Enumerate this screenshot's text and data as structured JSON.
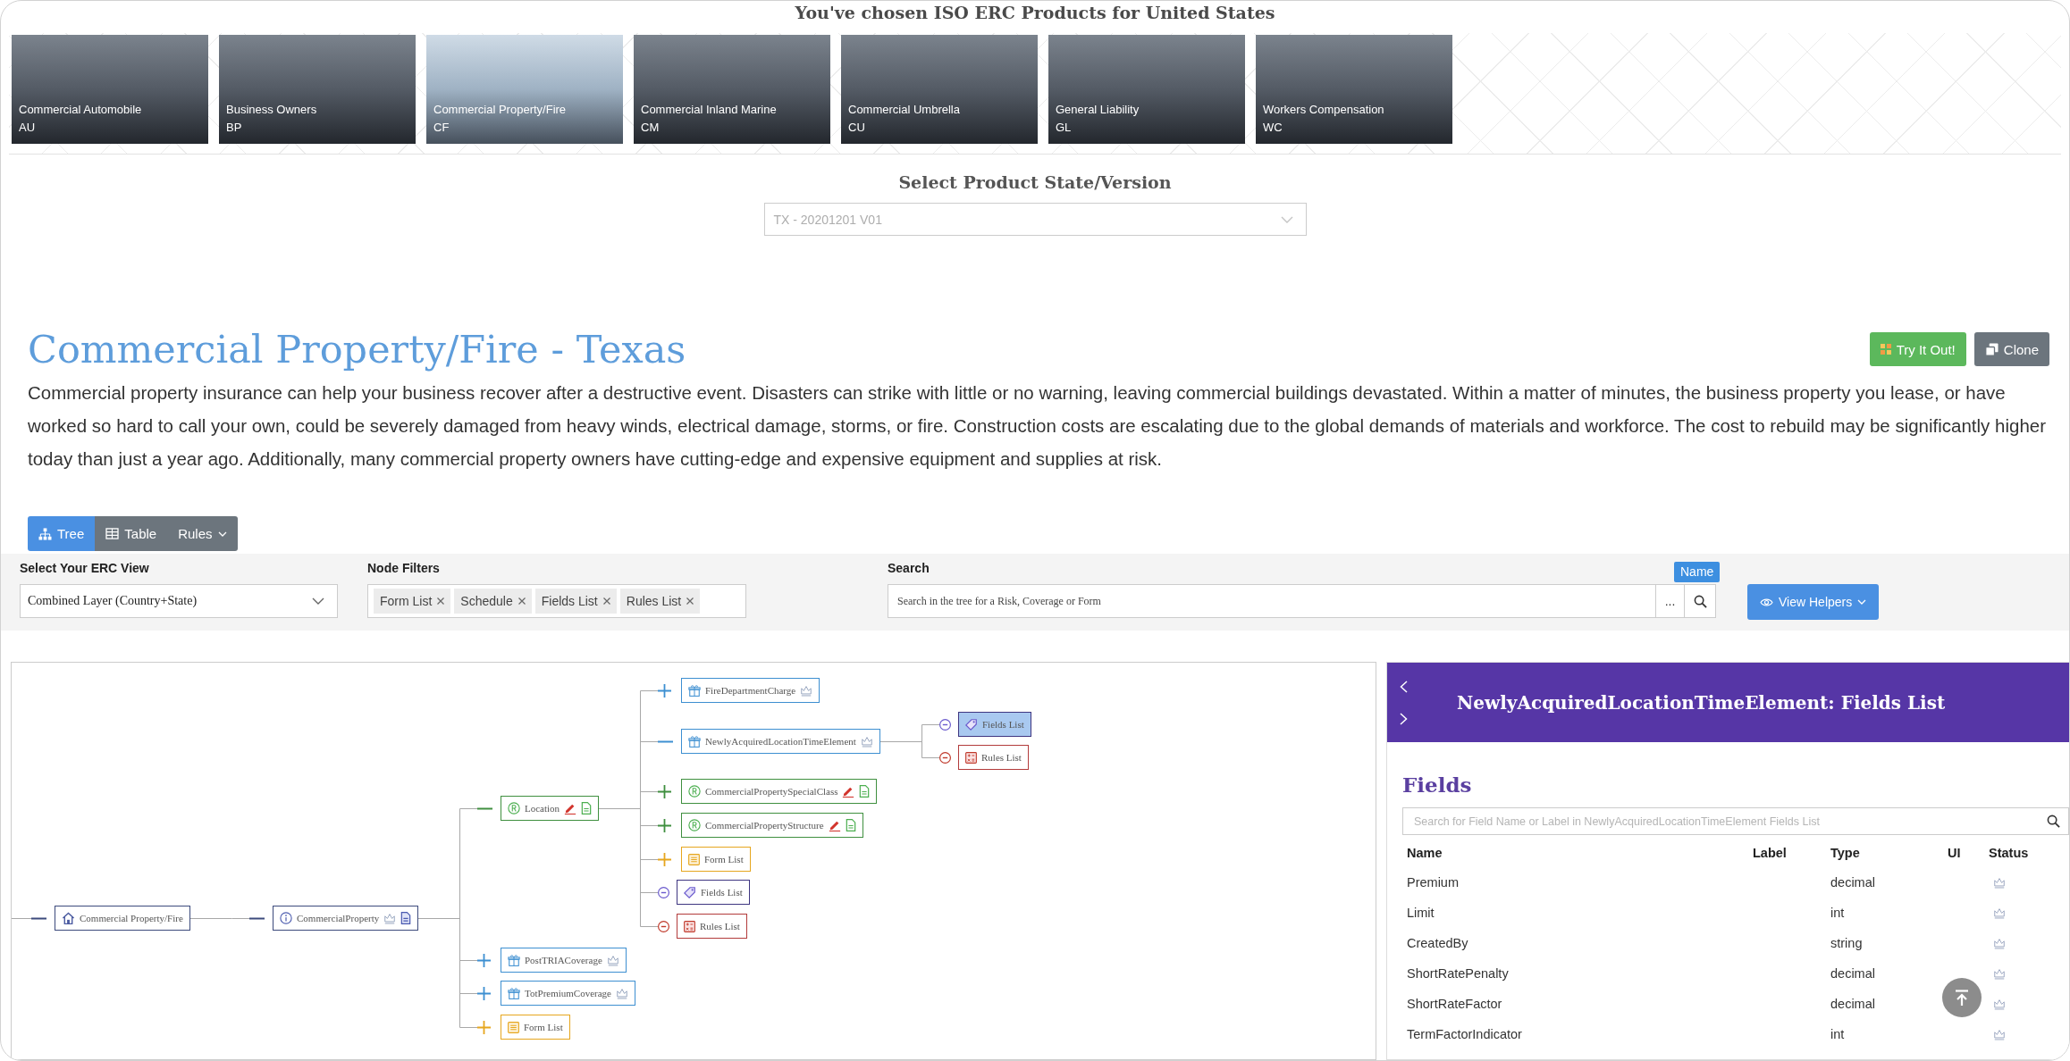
{
  "header": {
    "title": "You've chosen ISO ERC Products for United States"
  },
  "products": [
    {
      "name": "Commercial Automobile",
      "code": "AU",
      "selected": false
    },
    {
      "name": "Business Owners",
      "code": "BP",
      "selected": false
    },
    {
      "name": "Commercial Property/Fire",
      "code": "CF",
      "selected": true
    },
    {
      "name": "Commercial Inland Marine",
      "code": "CM",
      "selected": false
    },
    {
      "name": "Commercial Umbrella",
      "code": "CU",
      "selected": false
    },
    {
      "name": "General Liability",
      "code": "GL",
      "selected": false
    },
    {
      "name": "Workers Compensation",
      "code": "WC",
      "selected": false
    }
  ],
  "version_select": {
    "label": "Select Product State/Version",
    "value": "TX - 20201201 V01",
    "disabled": true
  },
  "product": {
    "title": "Commercial Property/Fire - Texas",
    "actions": [
      {
        "kind": "try",
        "label": "Try It Out!"
      },
      {
        "kind": "clone",
        "label": "Clone"
      }
    ],
    "description": "Commercial property insurance can help your business recover after a destructive event. Disasters can strike with little or no warning, leaving commercial buildings devastated. Within a matter of minutes, the business property you lease, or have worked so hard to call your own, could be severely damaged from heavy winds, electrical damage, storms, or fire. Construction costs are escalating due to the global demands of materials and workforce. The cost to rebuild may be significantly higher today than just a year ago. Additionally, many commercial property owners have cutting-edge and expensive equipment and supplies at risk."
  },
  "view_tabs": [
    {
      "label": "Tree",
      "kind": "tree",
      "selected": true
    },
    {
      "label": "Table",
      "kind": "table",
      "selected": false
    },
    {
      "label": "Rules",
      "kind": "rules",
      "selected": false
    }
  ],
  "filters": {
    "erc_view": {
      "label": "Select Your ERC View",
      "value": "Combined Layer (Country+State)"
    },
    "node_filters": {
      "label": "Node Filters",
      "chips": [
        "Form List",
        "Schedule",
        "Fields List",
        "Rules List"
      ]
    },
    "search": {
      "label": "Search",
      "placeholder": "Search in the tree for a Risk, Coverage or Form",
      "more": "...",
      "tooltip": "Name"
    },
    "helpers_button": "View Helpers"
  },
  "tree": {
    "label": "Commercial Property/Fire",
    "kind": "product",
    "expanded": true,
    "selected": false,
    "children": [
      {
        "label": "CommercialProperty",
        "kind": "line",
        "expanded": true,
        "selected": false,
        "children": [
          {
            "label": "Location",
            "kind": "risk",
            "expanded": true,
            "selected": false,
            "children": [
              {
                "label": "FireDepartmentCharge",
                "kind": "coverage",
                "expanded": false,
                "selected": false
              },
              {
                "label": "NewlyAcquiredLocationTimeElement",
                "kind": "coverage",
                "expanded": true,
                "selected": false,
                "children": [
                  {
                    "label": "Fields List",
                    "kind": "fields_list",
                    "expanded": true,
                    "selected": true
                  },
                  {
                    "label": "Rules List",
                    "kind": "rules_list",
                    "expanded": true,
                    "selected": false
                  }
                ]
              },
              {
                "label": "CommercialPropertySpecialClass",
                "kind": "risk",
                "expanded": false,
                "selected": false
              },
              {
                "label": "CommercialPropertyStructure",
                "kind": "risk",
                "expanded": false,
                "selected": false
              },
              {
                "label": "Form List",
                "kind": "form_list",
                "expanded": false,
                "selected": false
              },
              {
                "label": "Fields List",
                "kind": "fields_list",
                "expanded": true,
                "selected": false
              },
              {
                "label": "Rules List",
                "kind": "rules_list",
                "expanded": true,
                "selected": false
              }
            ]
          },
          {
            "label": "PostTRIACoverage",
            "kind": "coverage",
            "expanded": false,
            "selected": false
          },
          {
            "label": "TotPremiumCoverage",
            "kind": "coverage",
            "expanded": false,
            "selected": false
          },
          {
            "label": "Form List",
            "kind": "form_list",
            "expanded": false,
            "selected": false
          }
        ]
      }
    ]
  },
  "detail_panel": {
    "title": "NewlyAcquiredLocationTimeElement: Fields List",
    "heading": "Fields",
    "search_placeholder": "Search for Field Name or Label in NewlyAcquiredLocationTimeElement Fields List",
    "columns": [
      "Name",
      "Label",
      "Type",
      "UI",
      "Status"
    ],
    "rows": [
      {
        "name": "Premium",
        "type": "decimal"
      },
      {
        "name": "Limit",
        "type": "int"
      },
      {
        "name": "CreatedBy",
        "type": "string"
      },
      {
        "name": "ShortRatePenalty",
        "type": "decimal"
      },
      {
        "name": "ShortRateFactor",
        "type": "decimal"
      },
      {
        "name": "TermFactorIndicator",
        "type": "int"
      }
    ]
  }
}
